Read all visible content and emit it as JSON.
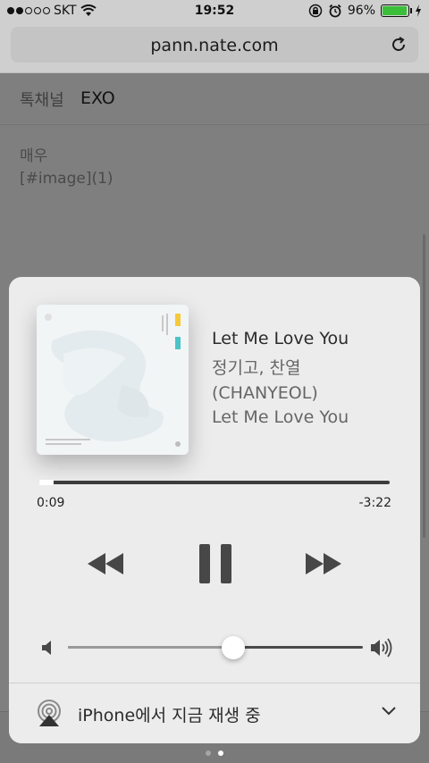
{
  "status_bar": {
    "carrier": "SKT",
    "time": "19:52",
    "battery_percent": "96%",
    "battery_level": 0.96,
    "icons": [
      "signal-dots",
      "wifi-icon",
      "rotation-lock-icon",
      "alarm-icon",
      "battery-icon",
      "charging-icon"
    ]
  },
  "browser": {
    "url": "pann.nate.com",
    "reload_icon": "reload-icon"
  },
  "page": {
    "channel_label": "톡채널",
    "channel_value": "EXO",
    "content_lines": [
      "매우",
      "[#image](1)"
    ]
  },
  "player": {
    "title": "Let Me Love You",
    "artist": "정기고, 찬열 (CHANYEOL)",
    "album": "Let Me Love You",
    "elapsed": "0:09",
    "remaining": "-3:22",
    "progress_fraction": 0.03,
    "volume_fraction": 0.56,
    "controls": {
      "previous": "rewind-icon",
      "play_pause": "pause-icon",
      "next": "fast-forward-icon"
    },
    "airplay_text": "iPhone에서 지금 재생 중"
  },
  "page_control": {
    "count": 2,
    "active_index": 1
  },
  "colors": {
    "card_bg": "#ececec",
    "dim_bg": "#7f7f7f",
    "battery_green": "#3bbf3b"
  }
}
